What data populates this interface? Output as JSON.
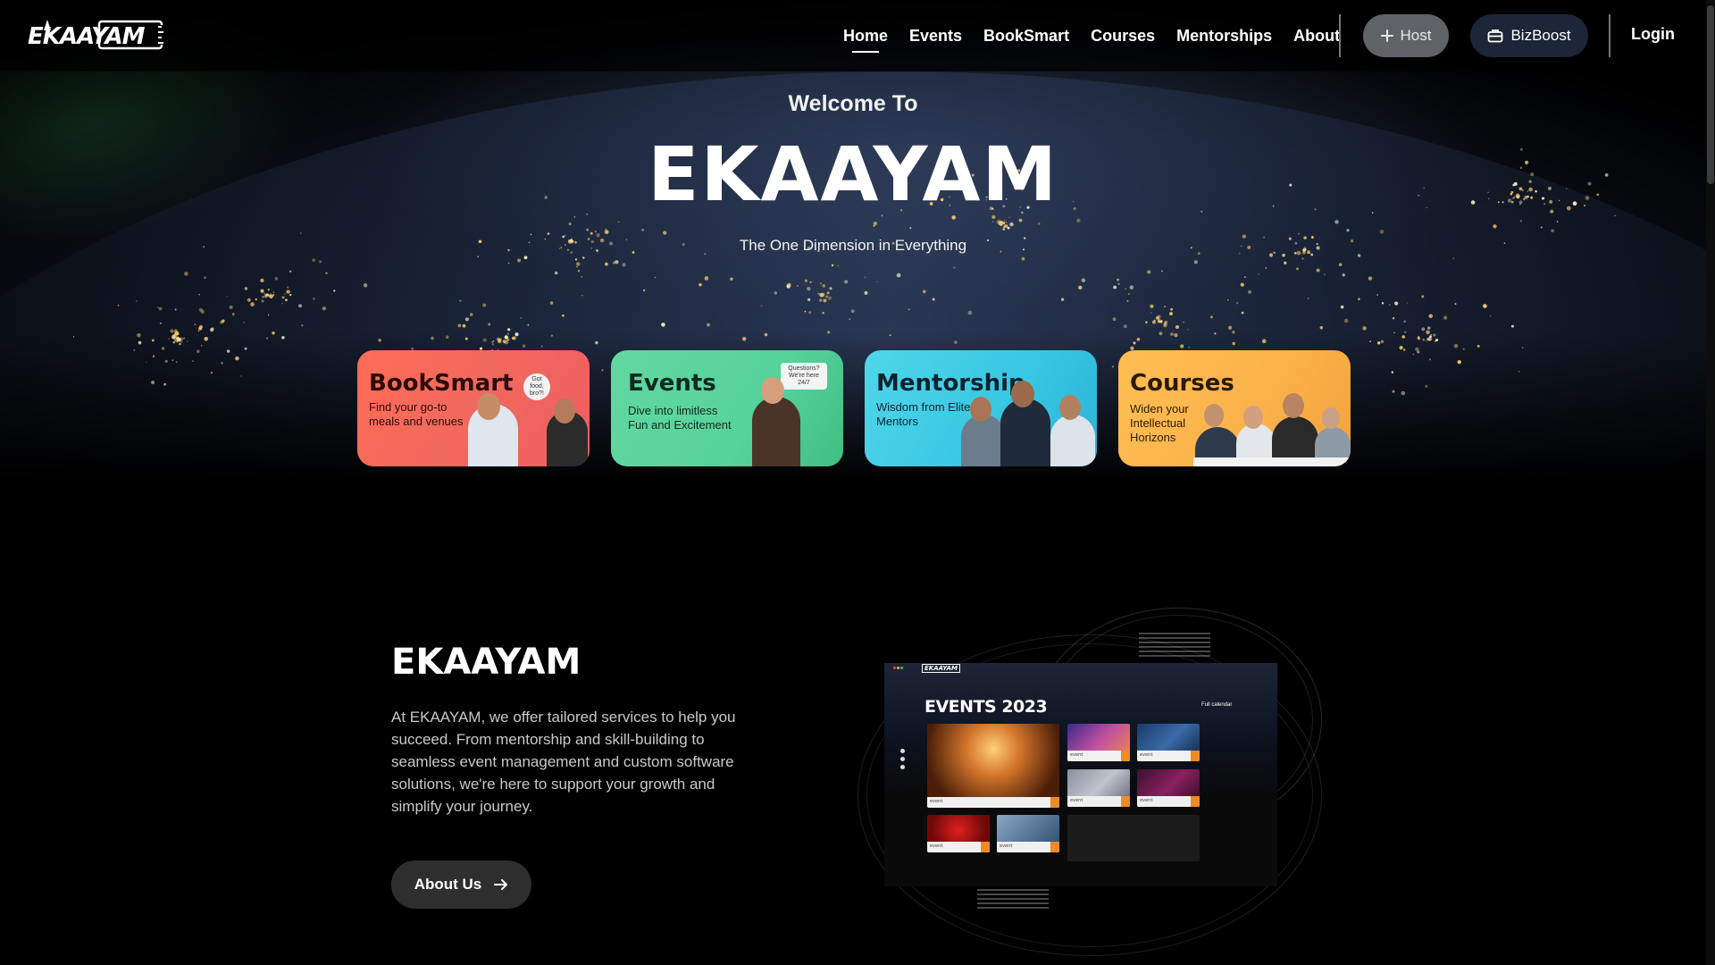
{
  "brand": {
    "logo_text": "EKAAYAM"
  },
  "nav": {
    "links": [
      "Home",
      "Events",
      "BookSmart",
      "Courses",
      "Mentorships",
      "About"
    ],
    "active": "Home",
    "host_label": "Host",
    "bizboost_label": "BizBoost",
    "login_label": "Login"
  },
  "hero": {
    "welcome": "Welcome To",
    "title": "EKAAYAM",
    "tagline": "The One Dimension in Everything"
  },
  "cards": [
    {
      "title": "BookSmart",
      "desc": "Find your go-to meals and venues",
      "bubble": "Got food, bro?!",
      "color": "#f26a5d"
    },
    {
      "title": "Events",
      "desc": "Dive into limitless Fun and Excitement",
      "bubble": "Questions? We're here 24/7",
      "color": "#57d29b"
    },
    {
      "title": "Mentorship",
      "desc": "Wisdom from Elite Mentors",
      "color": "#38c6e2"
    },
    {
      "title": "Courses",
      "desc": "Widen your Intellectual Horizons",
      "color": "#fbb14a"
    }
  ],
  "about": {
    "title": "EKAAYAM",
    "text": "At EKAAYAM, we offer tailored services to help you succeed. From mentorship and skill-building to seamless event management and custom software solutions, we're here to support your growth and simplify your journey.",
    "button": "About Us"
  },
  "mockup": {
    "logo_text": "EKAAYAM",
    "heading": "EVENTS 2023",
    "calendar_link": "Full calendar"
  }
}
